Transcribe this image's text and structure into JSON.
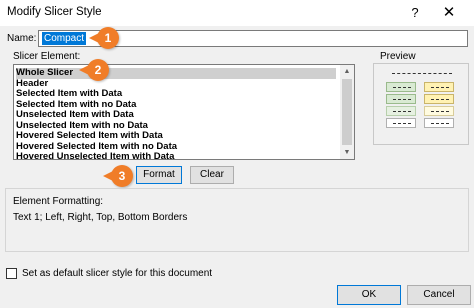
{
  "window": {
    "title": "Modify Slicer Style",
    "help_glyph": "?",
    "close_glyph": "✕"
  },
  "name_field": {
    "label": "Name:",
    "value": "Compact"
  },
  "callouts": [
    "1",
    "2",
    "3"
  ],
  "slicer_element": {
    "label": "Slicer Element:",
    "items": [
      {
        "label": "Whole Slicer",
        "selected": true
      },
      {
        "label": "Header"
      },
      {
        "label": "Selected Item with Data"
      },
      {
        "label": "Selected Item with no Data"
      },
      {
        "label": "Unselected Item with Data"
      },
      {
        "label": "Unselected Item with no Data"
      },
      {
        "label": "Hovered Selected Item with Data"
      },
      {
        "label": "Hovered Selected Item with no Data"
      },
      {
        "label": "Hovered Unselected Item with Data"
      }
    ],
    "scroll_up": "▲",
    "scroll_down": "▼"
  },
  "buttons": {
    "format": "Format",
    "clear": "Clear",
    "ok": "OK",
    "cancel": "Cancel"
  },
  "preview": {
    "label": "Preview"
  },
  "element_formatting": {
    "label": "Element Formatting:",
    "text": "Text 1; Left, Right, Top, Bottom Borders"
  },
  "default_checkbox": {
    "label": "Set as default slicer style for this document",
    "checked": false
  },
  "colors": {
    "accent": "#0078d7",
    "callout": "#f07d28",
    "selected_row": "#cfcfcf"
  }
}
